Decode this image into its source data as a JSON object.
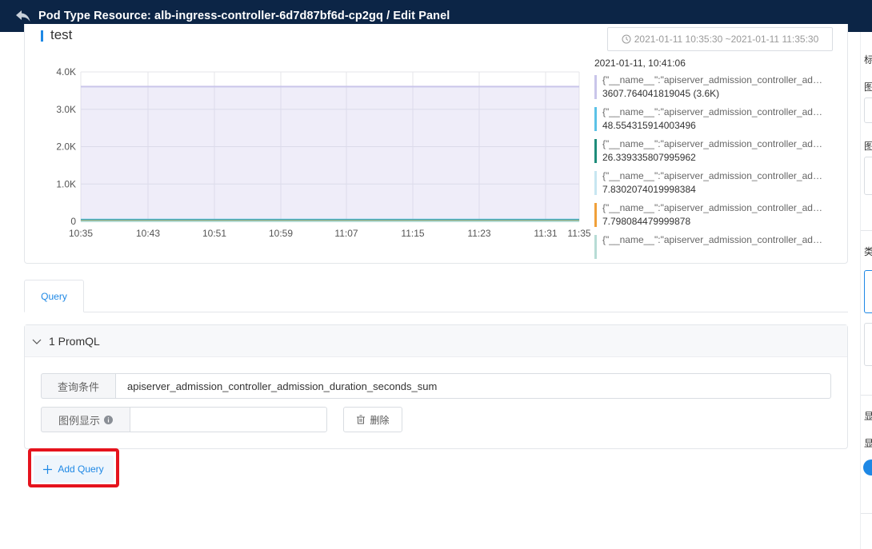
{
  "header": {
    "title": "Pod Type Resource: alb-ingress-controller-6d7d87bf6d-cp2gq / Edit Panel"
  },
  "panel": {
    "title": "test",
    "time_range": "2021-01-11 10:35:30 ~2021-01-11 11:35:30"
  },
  "chart_data": {
    "type": "area",
    "y_ticks": [
      "0",
      "1.0K",
      "2.0K",
      "3.0K",
      "4.0K"
    ],
    "ylim": [
      0,
      4000
    ],
    "x_ticks": [
      "10:35",
      "10:43",
      "10:51",
      "10:59",
      "11:07",
      "11:15",
      "11:23",
      "11:31",
      "11:35"
    ],
    "grid": true,
    "legend_position": "right",
    "series": [
      {
        "value": 3607.764041819045,
        "color": "#c9c5ea"
      },
      {
        "value": 48.554315914003496,
        "color": "#5bc2e7"
      },
      {
        "value": 26.339335807995962,
        "color": "#1e8c7a"
      },
      {
        "value": 7.8302074019998384,
        "color": "#c7e6f1"
      },
      {
        "value": 7.798084479999878,
        "color": "#f0a03a"
      },
      {
        "value": 0,
        "color": "#b7dcd5"
      }
    ]
  },
  "legend": {
    "timestamp": "2021-01-11, 10:41:06",
    "items": [
      {
        "name": "{\"__name__\":\"apiserver_admission_controller_admission_duration_seconds_sum\"}",
        "value": "3607.764041819045 (3.6K)",
        "color": "#c9c5ea"
      },
      {
        "name": "{\"__name__\":\"apiserver_admission_controller_admission_duration_seconds_sum\"}",
        "value": "48.554315914003496",
        "color": "#5bc2e7"
      },
      {
        "name": "{\"__name__\":\"apiserver_admission_controller_admission_duration_seconds_sum\"}",
        "value": "26.339335807995962",
        "color": "#1e8c7a"
      },
      {
        "name": "{\"__name__\":\"apiserver_admission_controller_admission_duration_seconds_sum\"}",
        "value": "7.8302074019998384",
        "color": "#c7e6f1"
      },
      {
        "name": "{\"__name__\":\"apiserver_admission_controller_admission_duration_seconds_sum\"}",
        "value": "7.798084479999878",
        "color": "#f0a03a"
      },
      {
        "name": "{\"__name__\":\"apiserver_admission_controller_admission_duration_seconds_sum\"}",
        "value": "",
        "color": "#b7dcd5"
      }
    ]
  },
  "tabs": {
    "query": "Query"
  },
  "query": {
    "head_label": "1 PromQL",
    "condition_label": "查询条件",
    "condition_value": "apiserver_admission_controller_admission_duration_seconds_sum",
    "legend_label": "图例显示",
    "legend_value": "",
    "delete_label": "删除",
    "add_label": "Add Query"
  },
  "sidebar": {
    "t1": "标",
    "t2": "图",
    "t3": "图",
    "t4": "类",
    "t5": "显",
    "t6": "显"
  },
  "colors": {
    "accent": "#1e88e5",
    "header_bg": "#0c2546",
    "highlight": "#e5131d"
  }
}
